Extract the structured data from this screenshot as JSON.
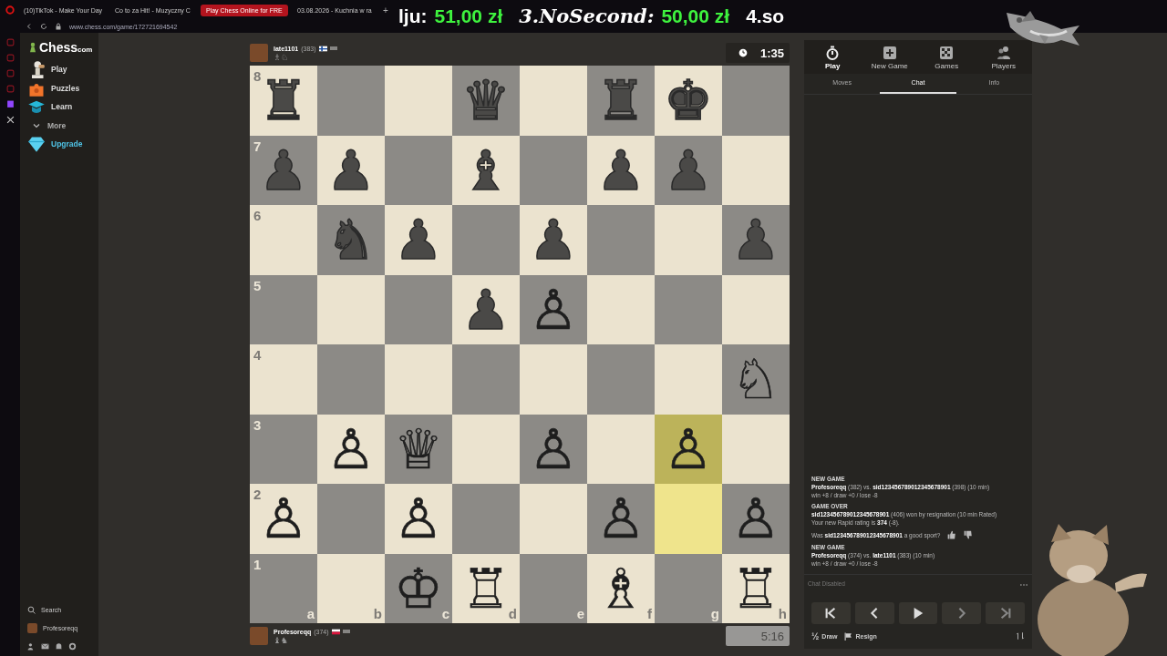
{
  "browser": {
    "tabs": [
      {
        "title": "(10)TikTok - Make Your Day",
        "selected": false
      },
      {
        "title": "Co to za Hit! - Muzyczny C",
        "selected": false
      },
      {
        "title": "Play Chess Online for FRE",
        "selected": true
      },
      {
        "title": "03.08.2026 - Kuchnia w ra",
        "selected": false
      }
    ],
    "new_tab": "+",
    "url": "www.chess.com/game/172721694542"
  },
  "overlay": [
    {
      "name": "lju:",
      "amount": "51,00 zł"
    },
    {
      "name": "3.NoSecond:",
      "amount": "50,00 zł",
      "kind": "script"
    },
    {
      "name": "4.so"
    }
  ],
  "nav": {
    "logo": "Chess",
    "logo_suffix": "com",
    "items": [
      {
        "label": "Play",
        "kind": "play"
      },
      {
        "label": "Puzzles",
        "kind": "puzzles"
      },
      {
        "label": "Learn",
        "kind": "learn"
      },
      {
        "label": "More",
        "kind": "more"
      },
      {
        "label": "Upgrade",
        "kind": "upgrade"
      }
    ],
    "search": "Search",
    "user": "Profesoreqq"
  },
  "top_player": {
    "name": "late1101",
    "rating": "(383)",
    "captured": "♗♘",
    "clock": "1:35",
    "active": true
  },
  "bottom_player": {
    "name": "Profesoreqq",
    "rating": "(374)",
    "captured": "♝♞",
    "clock": "5:16",
    "active": false
  },
  "board": {
    "files": [
      "a",
      "b",
      "c",
      "d",
      "e",
      "f",
      "g",
      "h"
    ],
    "ranks": [
      {
        "label": "8",
        "squares": [
          {
            "kind": "black",
            "piece": "♜"
          },
          {
            "kind": "empty"
          },
          {
            "kind": "empty"
          },
          {
            "kind": "black",
            "piece": "♛"
          },
          {
            "kind": "empty"
          },
          {
            "kind": "black",
            "piece": "♜"
          },
          {
            "kind": "black",
            "piece": "♚"
          },
          {
            "kind": "empty"
          }
        ]
      },
      {
        "label": "7",
        "squares": [
          {
            "kind": "black",
            "piece": "♟"
          },
          {
            "kind": "black",
            "piece": "♟"
          },
          {
            "kind": "empty"
          },
          {
            "kind": "black",
            "piece": "♝"
          },
          {
            "kind": "empty"
          },
          {
            "kind": "black",
            "piece": "♟"
          },
          {
            "kind": "black",
            "piece": "♟"
          },
          {
            "kind": "empty"
          }
        ]
      },
      {
        "label": "6",
        "squares": [
          {
            "kind": "empty"
          },
          {
            "kind": "black",
            "piece": "♞"
          },
          {
            "kind": "black",
            "piece": "♟"
          },
          {
            "kind": "empty"
          },
          {
            "kind": "black",
            "piece": "♟"
          },
          {
            "kind": "empty"
          },
          {
            "kind": "empty"
          },
          {
            "kind": "black",
            "piece": "♟"
          }
        ]
      },
      {
        "label": "5",
        "squares": [
          {
            "kind": "empty"
          },
          {
            "kind": "empty"
          },
          {
            "kind": "empty"
          },
          {
            "kind": "black",
            "piece": "♟"
          },
          {
            "kind": "white",
            "piece": "♙"
          },
          {
            "kind": "empty"
          },
          {
            "kind": "empty"
          },
          {
            "kind": "empty"
          }
        ]
      },
      {
        "label": "4",
        "squares": [
          {
            "kind": "empty"
          },
          {
            "kind": "empty"
          },
          {
            "kind": "empty"
          },
          {
            "kind": "empty"
          },
          {
            "kind": "empty"
          },
          {
            "kind": "empty"
          },
          {
            "kind": "empty"
          },
          {
            "kind": "white",
            "piece": "♘"
          }
        ]
      },
      {
        "label": "3",
        "squares": [
          {
            "kind": "empty"
          },
          {
            "kind": "white",
            "piece": "♙"
          },
          {
            "kind": "white",
            "piece": "♕"
          },
          {
            "kind": "empty"
          },
          {
            "kind": "white",
            "piece": "♙"
          },
          {
            "kind": "empty"
          },
          {
            "kind": "white",
            "piece": "♙",
            "highlight": true
          },
          {
            "kind": "empty"
          }
        ]
      },
      {
        "label": "2",
        "squares": [
          {
            "kind": "white",
            "piece": "♙"
          },
          {
            "kind": "empty"
          },
          {
            "kind": "white",
            "piece": "♙"
          },
          {
            "kind": "empty"
          },
          {
            "kind": "empty"
          },
          {
            "kind": "white",
            "piece": "♙"
          },
          {
            "kind": "empty",
            "highlight": true
          },
          {
            "kind": "white",
            "piece": "♙"
          }
        ]
      },
      {
        "label": "1",
        "squares": [
          {
            "kind": "empty"
          },
          {
            "kind": "empty"
          },
          {
            "kind": "white",
            "piece": "♔"
          },
          {
            "kind": "white",
            "piece": "♖"
          },
          {
            "kind": "empty"
          },
          {
            "kind": "white",
            "piece": "♗"
          },
          {
            "kind": "empty"
          },
          {
            "kind": "white",
            "piece": "♖"
          }
        ]
      }
    ]
  },
  "panel": {
    "nav": [
      {
        "label": "Play",
        "kind": "play",
        "selected": true
      },
      {
        "label": "New Game",
        "kind": "new",
        "selected": false
      },
      {
        "label": "Games",
        "kind": "games",
        "selected": false
      },
      {
        "label": "Players",
        "kind": "players",
        "selected": false
      }
    ],
    "tabs": [
      {
        "label": "Moves",
        "selected": false
      },
      {
        "label": "Chat",
        "selected": true
      },
      {
        "label": "Info",
        "selected": false
      }
    ],
    "messages": [
      {
        "kind": "game",
        "title": "NEW GAME",
        "lines": [
          "**Profesoreqq** (382) vs. **sid123456789012345678901** (398) (10 min)",
          "win +8 / draw +0 / lose -8"
        ]
      },
      {
        "kind": "game",
        "title": "GAME OVER",
        "lines": [
          "**sid123456789012345678901** (406) won by resignation (10 min Rated)",
          "Your new Rapid rating is **374** (-8)."
        ]
      },
      {
        "kind": "feedback",
        "lines": [
          "Was **sid123456789012345678901** a good sport?"
        ]
      },
      {
        "kind": "game",
        "title": "NEW GAME",
        "lines": [
          "**Profesoreqq** (374) vs. **late1101** (383) (10 min)",
          "win +8 / draw +0 / lose -8"
        ]
      }
    ],
    "chat_status": "Chat Disabled",
    "controls": [
      {
        "kind": "first"
      },
      {
        "kind": "prev"
      },
      {
        "kind": "play"
      },
      {
        "kind": "next"
      },
      {
        "kind": "last"
      }
    ],
    "draw_glyph": "½",
    "draw": "Draw",
    "resign": "Resign"
  }
}
